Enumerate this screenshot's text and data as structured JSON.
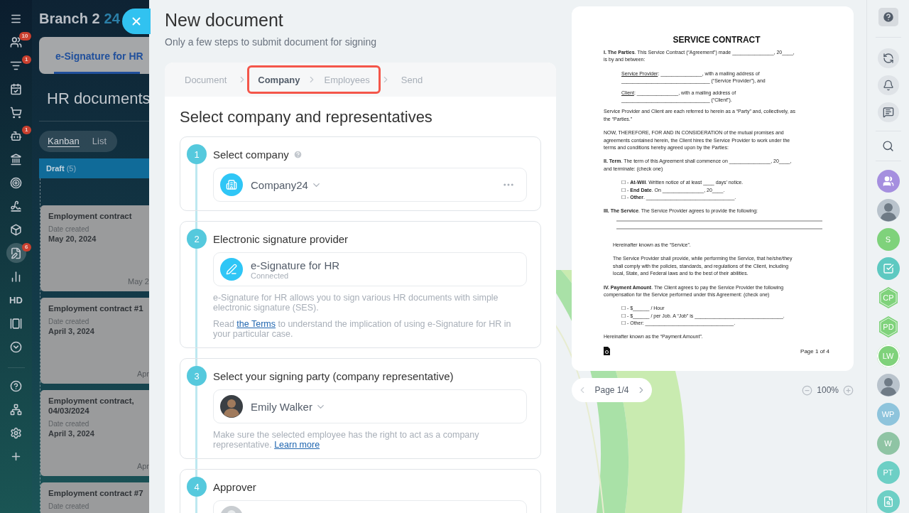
{
  "sidebar": {
    "items": [
      {
        "kind": "menu",
        "selected": false
      },
      {
        "kind": "people",
        "badge": "10",
        "selected": false
      },
      {
        "kind": "filter",
        "badge": "1",
        "selected": false
      },
      {
        "kind": "calendar",
        "selected": false
      },
      {
        "kind": "cart",
        "selected": false
      },
      {
        "kind": "robot",
        "badge": "1",
        "selected": false
      },
      {
        "kind": "bank",
        "selected": false
      },
      {
        "kind": "target",
        "selected": false
      },
      {
        "kind": "signature",
        "selected": false
      },
      {
        "kind": "box",
        "selected": false
      },
      {
        "kind": "document",
        "badge": "6",
        "selected": true
      },
      {
        "kind": "chart",
        "selected": false
      },
      {
        "kind": "text",
        "label": "HD",
        "selected": false
      },
      {
        "kind": "widget",
        "selected": false
      },
      {
        "kind": "more",
        "selected": false
      }
    ],
    "bottom_items": [
      {
        "kind": "help"
      },
      {
        "kind": "network"
      },
      {
        "kind": "settings"
      },
      {
        "kind": "add"
      }
    ]
  },
  "workspace": {
    "brand": "Branch 2",
    "brand_suffix": "24",
    "app_tabs": [
      {
        "label": "e-Signature for HR",
        "selected": true
      }
    ],
    "page_title": "HR documents",
    "view_switch": [
      {
        "label": "Kanban",
        "selected": true
      },
      {
        "label": "List",
        "selected": false
      }
    ],
    "column": {
      "title": "Draft",
      "count": "(5)",
      "cards": [
        {
          "title": "Employment contract",
          "date_label": "Date created",
          "date": "May 20, 2024",
          "footer": "May 2"
        },
        {
          "title": "Employment contract #1",
          "date_label": "Date created",
          "date": "April 3, 2024",
          "footer": "Apr"
        },
        {
          "title": "Employment contract, 04/03/2024",
          "date_label": "Date created",
          "date": "April 3, 2024",
          "footer": "Apr"
        },
        {
          "title": "Employment contract #7",
          "date_label": "Date created"
        }
      ]
    }
  },
  "panel": {
    "title": "New document",
    "subtitle": "Only a few steps to submit document for signing",
    "steps": [
      {
        "label": "Document",
        "selected": false,
        "highlighted": false
      },
      {
        "label": "Company",
        "selected": true,
        "highlighted": true
      },
      {
        "label": "Employees",
        "selected": false,
        "highlighted": true
      },
      {
        "label": "Send",
        "selected": false,
        "highlighted": false
      }
    ],
    "heading": "Select company and representatives",
    "sections": [
      {
        "number": "1",
        "title": "Select company",
        "help": true,
        "field": {
          "kind": "company",
          "value": "Company24",
          "dropdown": true,
          "menu": true
        }
      },
      {
        "number": "2",
        "title": "Electronic signature provider",
        "field": {
          "kind": "provider",
          "value": "e-Signature for HR",
          "status": "Connected"
        },
        "notes": [
          [
            {
              "text": "e-Signature for HR allows you to sign various HR documents with simple electronic signature (SES)."
            }
          ],
          [
            {
              "text": "Read "
            },
            {
              "link": "the Terms"
            },
            {
              "text": " to understand the implication of using e-Signature for HR in your particular case."
            }
          ]
        ]
      },
      {
        "number": "3",
        "title": "Select your signing party (company representative)",
        "field": {
          "kind": "person",
          "value": "Emily Walker",
          "dropdown": true
        },
        "notes": [
          [
            {
              "text": "Make sure the selected employee has the right to act as a company representative. "
            },
            {
              "link": "Learn more"
            }
          ]
        ]
      },
      {
        "number": "4",
        "title": "Approver",
        "field": {
          "kind": "placeholder"
        }
      }
    ]
  },
  "document": {
    "title": "SERVICE CONTRACT",
    "blocks": [
      {
        "kind": "para",
        "lines": [
          "**I. The Parties**. This Service Contract (“Agreement”) made _______________, 20____,",
          "is by and between:"
        ]
      },
      {
        "kind": "party",
        "label": "Service Provider",
        "lines": [
          ": _______________, with a mailing address of",
          "________________________________ (“Service Provider”), and"
        ]
      },
      {
        "kind": "party",
        "label": "Client",
        "lines": [
          ": _______________, with a mailing address of",
          "________________________________ (“Client”)."
        ]
      },
      {
        "kind": "para",
        "lines": [
          "Service Provider and Client are each referred to herein as a “Party” and, collectively, as",
          "the “Parties.”"
        ]
      },
      {
        "kind": "para",
        "lines": [
          "NOW, THEREFORE, FOR AND IN CONSIDERATION of the mutual promises and",
          "agreements contained herein, the Client hires the Service Provider to work under the",
          "terms and conditions hereby agreed upon by the Parties:"
        ]
      },
      {
        "kind": "para",
        "lines": [
          "**II. Term**. The term of this Agreement shall commence on _______________, 20____,",
          "and terminate: (check one)"
        ]
      },
      {
        "kind": "checklist",
        "lines": [
          "☐ - **At-Will**. Written notice of at least ____ days’ notice.",
          "☐ - **End Date**. On _______________, 20____.",
          "☐ - **Other**. ________________________________."
        ]
      },
      {
        "kind": "para",
        "lines": [
          "**III. The Service**. The Service Provider agrees to provide the following:"
        ]
      },
      {
        "kind": "blank_lines"
      },
      {
        "kind": "indent",
        "lines": [
          "Hereinafter known as the “Service”."
        ]
      },
      {
        "kind": "indent",
        "lines": [
          "The Service Provider shall provide, while performing the Service, that he/she/they",
          "shall comply with the policies, standards, and regulations of the Client, including",
          "local, State, and Federal laws and to the best of their abilities."
        ]
      },
      {
        "kind": "para",
        "lines": [
          "**IV. Payment Amount**. The Client agrees to pay the Service Provider the following",
          "compensation for the Service performed under this Agreement: (check one)"
        ]
      },
      {
        "kind": "checklist",
        "lines": [
          "☐ - $______ / Hour",
          "☐ - $______ / per Job. A “Job” is ________________________________.",
          "☐ - Other: ________________________________."
        ]
      },
      {
        "kind": "para",
        "lines": [
          "Hereinafter known as the “Payment Amount”."
        ]
      }
    ],
    "footer": "Page 1 of 4"
  },
  "pager": {
    "label": "Page 1/4",
    "zoom": "100%"
  },
  "rail": {
    "buttons": [
      {
        "kind": "copilot"
      },
      {
        "kind": "bell"
      },
      {
        "kind": "chat"
      }
    ],
    "avatars": [
      {
        "kind": "group",
        "color": "#a58fdf"
      },
      {
        "kind": "photo"
      },
      {
        "kind": "initials",
        "text": "S",
        "color": "#7fd27b"
      },
      {
        "kind": "task",
        "color": "#5ec9c1"
      },
      {
        "kind": "hex",
        "text": "CP",
        "color": "#7fd27b"
      },
      {
        "kind": "hex",
        "text": "PD",
        "color": "#7fd27b"
      },
      {
        "kind": "ring",
        "text": "LW",
        "color": "#7fd27b"
      },
      {
        "kind": "photo"
      },
      {
        "kind": "initials",
        "text": "WP",
        "color": "#8ec4dc"
      },
      {
        "kind": "initials",
        "text": "W",
        "color": "#8fc4a4"
      },
      {
        "kind": "initials",
        "text": "PT",
        "color": "#6dcfc5"
      },
      {
        "kind": "search",
        "color": "#6dcfc5"
      }
    ]
  }
}
